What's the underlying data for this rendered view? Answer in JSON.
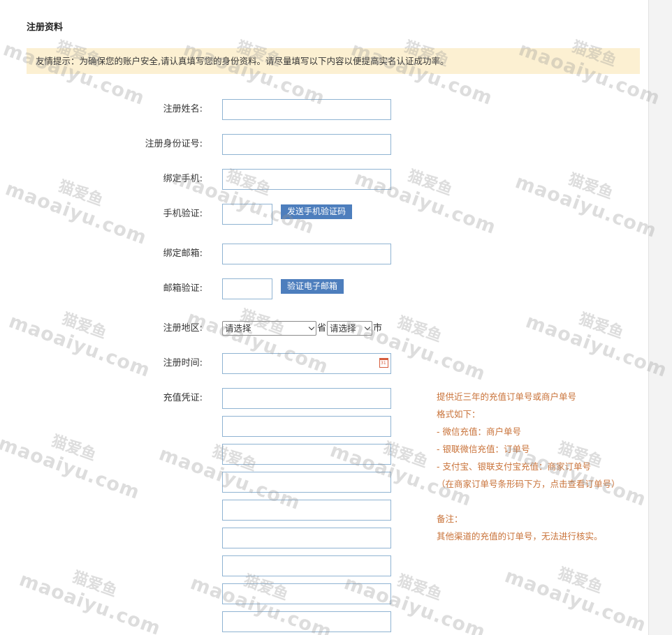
{
  "form": {
    "title": "注册资料",
    "notice": "友情提示：为确保您的账户安全,请认真填写您的身份资料。请尽量填写以下内容以便提高实名认证成功率。",
    "fields": {
      "name_label": "注册姓名:",
      "idcard_label": "注册身份证号:",
      "phone_label": "绑定手机:",
      "phone_code_label": "手机验证:",
      "send_code_button": "发送手机验证码",
      "email_label": "绑定邮箱:",
      "email_code_label": "邮箱验证:",
      "verify_email_button": "验证电子邮箱",
      "region_label": "注册地区:",
      "province_select": "请选择",
      "province_suffix": "省",
      "city_select": "请选择",
      "city_suffix": "市",
      "time_label": "注册时间:",
      "calendar_glyph": "31",
      "voucher_label": "充值凭证:"
    },
    "voucher_inputs_count": 9,
    "hint": {
      "line1": "提供近三年的充值订单号或商户单号",
      "line2": "格式如下：",
      "line3": "- 微信充值：商户单号",
      "line4": "- 银联微信充值：订单号",
      "line5": "- 支付宝、银联支付宝充值：商家订单号",
      "line6": "（在商家订单号条形码下方，点击查看订单号）",
      "line7": "备注：",
      "line8": "其他渠道的充值的订单号，无法进行核实。"
    }
  },
  "watermark": {
    "cn": "猫爱鱼",
    "en": "maoaiyu.com"
  },
  "colors": {
    "notice_bg": "#fcf0d2",
    "input_border": "#8fb3d2",
    "button_bg": "#4d7ebd",
    "hint_text": "#c9733a"
  }
}
